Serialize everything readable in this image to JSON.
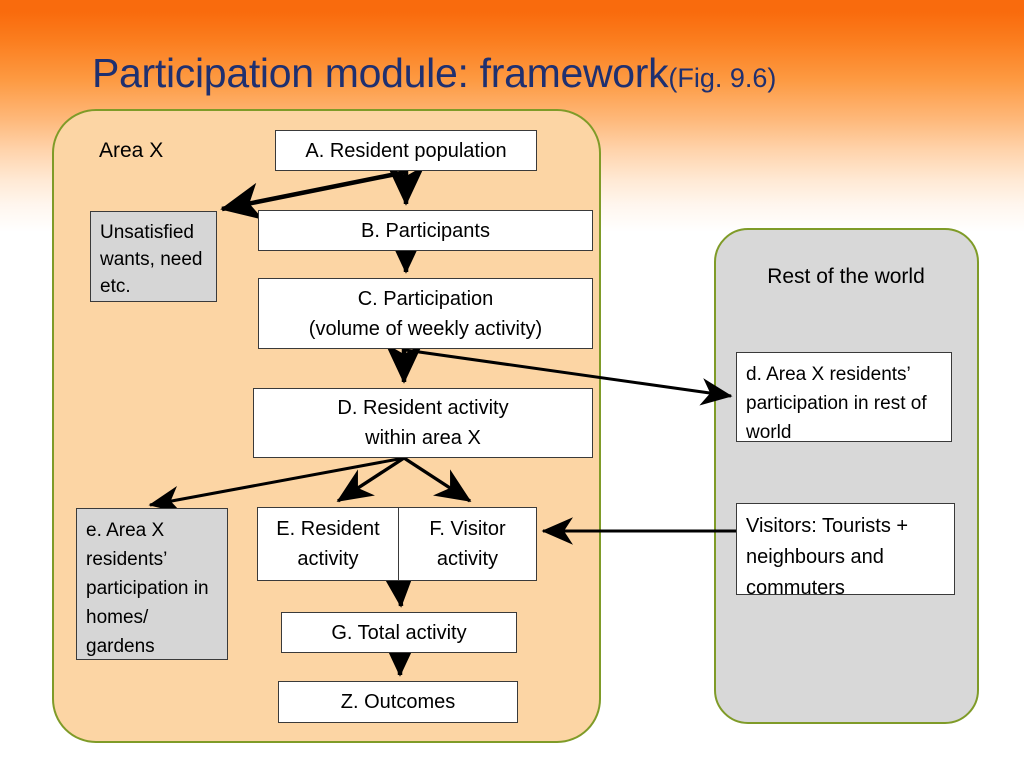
{
  "slide": {
    "title_main": "Participation module: framework",
    "title_sub": "(Fig. 9.6)",
    "title_color": "#1f3070",
    "background_accent": "#f96b0d"
  },
  "panels": {
    "area_x": {
      "label": "Area X",
      "fill": "#fcd5a4",
      "border": "#7f9b28"
    },
    "rest_of_world": {
      "label": "Rest of the world",
      "fill": "#d8d8d8",
      "border": "#7f9b28"
    }
  },
  "boxes": {
    "a": {
      "label": "A. Resident population",
      "fill": "#ffffff"
    },
    "unsatisfied": {
      "label": "Unsatisfied wants, need etc.",
      "fill": "#d6d6d6"
    },
    "b": {
      "label": "B. Participants",
      "fill": "#ffffff"
    },
    "c": {
      "label": "C. Participation\n(volume of weekly activity)",
      "fill": "#ffffff"
    },
    "d": {
      "label": "D. Resident activity\nwithin area X",
      "fill": "#ffffff"
    },
    "e_small": {
      "label": "e. Area X residents’ participation in homes/ gardens",
      "fill": "#d6d6d6"
    },
    "e": {
      "label": "E. Resident\nactivity",
      "fill": "#ffffff"
    },
    "f": {
      "label": "F. Visitor\nactivity",
      "fill": "#ffffff"
    },
    "g": {
      "label": "G. Total activity",
      "fill": "#ffffff"
    },
    "z": {
      "label": "Z. Outcomes",
      "fill": "#ffffff"
    },
    "d_small": {
      "label": "d. Area X residents’ participation in rest of world",
      "fill": "#ffffff"
    },
    "visitors": {
      "label": "Visitors: Tourists + neighbours and commuters",
      "fill": "#ffffff"
    }
  },
  "connectors": [
    {
      "name": "a-to-b",
      "from": "a",
      "to": "b",
      "style": "arrow-down"
    },
    {
      "name": "a-to-unsatisfied",
      "from": "a",
      "to": "unsatisfied",
      "style": "arrow-diagonal-left"
    },
    {
      "name": "b-to-c",
      "from": "b",
      "to": "c",
      "style": "arrow-down"
    },
    {
      "name": "c-to-d",
      "from": "c",
      "to": "d",
      "style": "arrow-down"
    },
    {
      "name": "c-to-d-small",
      "from": "c",
      "to": "d_small",
      "style": "arrow-diagonal-right"
    },
    {
      "name": "d-to-e-small",
      "from": "d",
      "to": "e_small",
      "style": "arrow-diagonal-left"
    },
    {
      "name": "d-to-e",
      "from": "d",
      "to": "e",
      "style": "arrow-diagonal-left-short"
    },
    {
      "name": "d-to-f",
      "from": "d",
      "to": "f",
      "style": "arrow-diagonal-right-short"
    },
    {
      "name": "visitors-to-f",
      "from": "visitors",
      "to": "f",
      "style": "arrow-left"
    },
    {
      "name": "ef-to-g",
      "from": "e",
      "to": "g",
      "style": "arrow-down"
    },
    {
      "name": "g-to-z",
      "from": "g",
      "to": "z",
      "style": "arrow-down"
    }
  ]
}
